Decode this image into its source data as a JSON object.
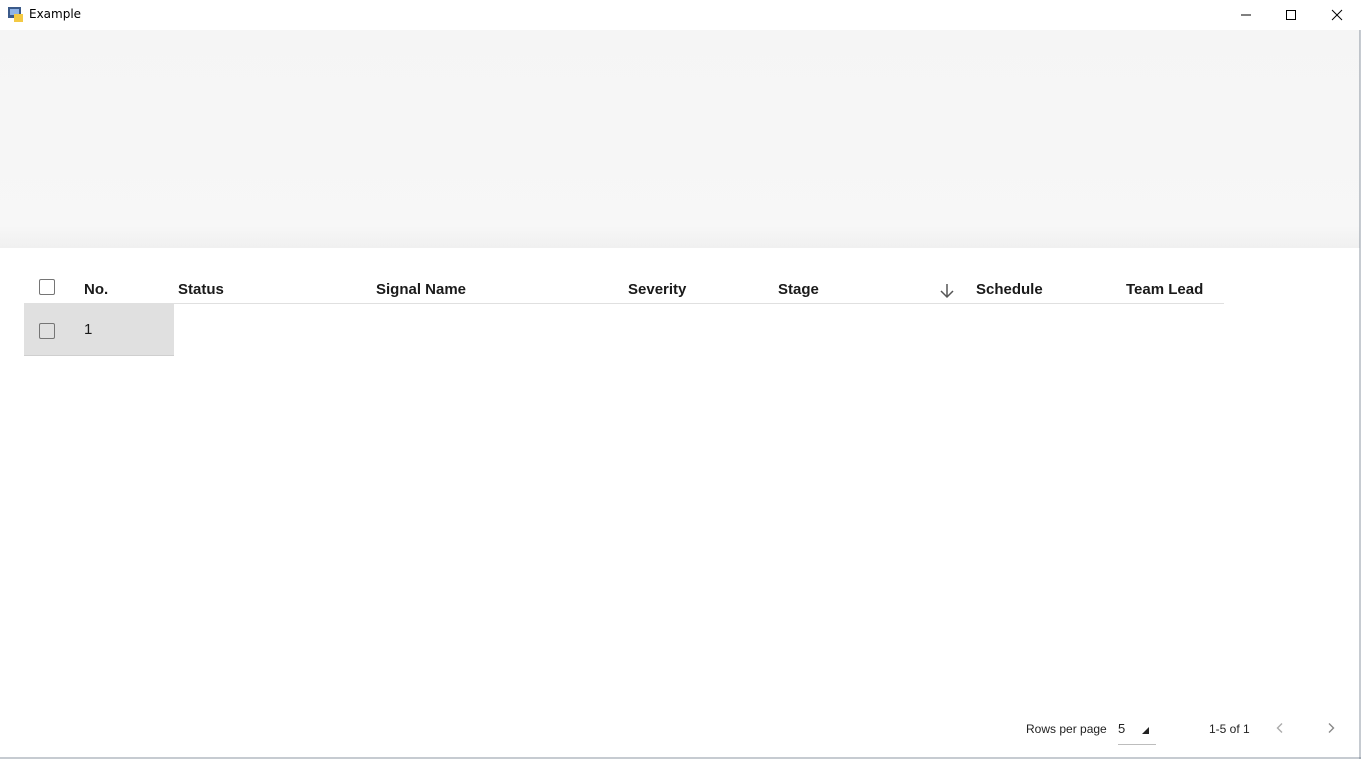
{
  "window": {
    "title": "Example",
    "icons": {
      "app": "python-app-icon",
      "minimize": "minimize-icon",
      "maximize": "maximize-icon",
      "close": "close-icon"
    }
  },
  "table": {
    "columns": [
      "No.",
      "Status",
      "Signal Name",
      "Severity",
      "Stage",
      "Schedule",
      "Team Lead"
    ],
    "sort": {
      "column": "Stage",
      "direction": "descending"
    },
    "rows": [
      {
        "no": "1"
      }
    ]
  },
  "pagination": {
    "rows_per_page_label": "Rows per page",
    "rows_per_page_value": "5",
    "range_label": "1-5 of 1"
  }
}
